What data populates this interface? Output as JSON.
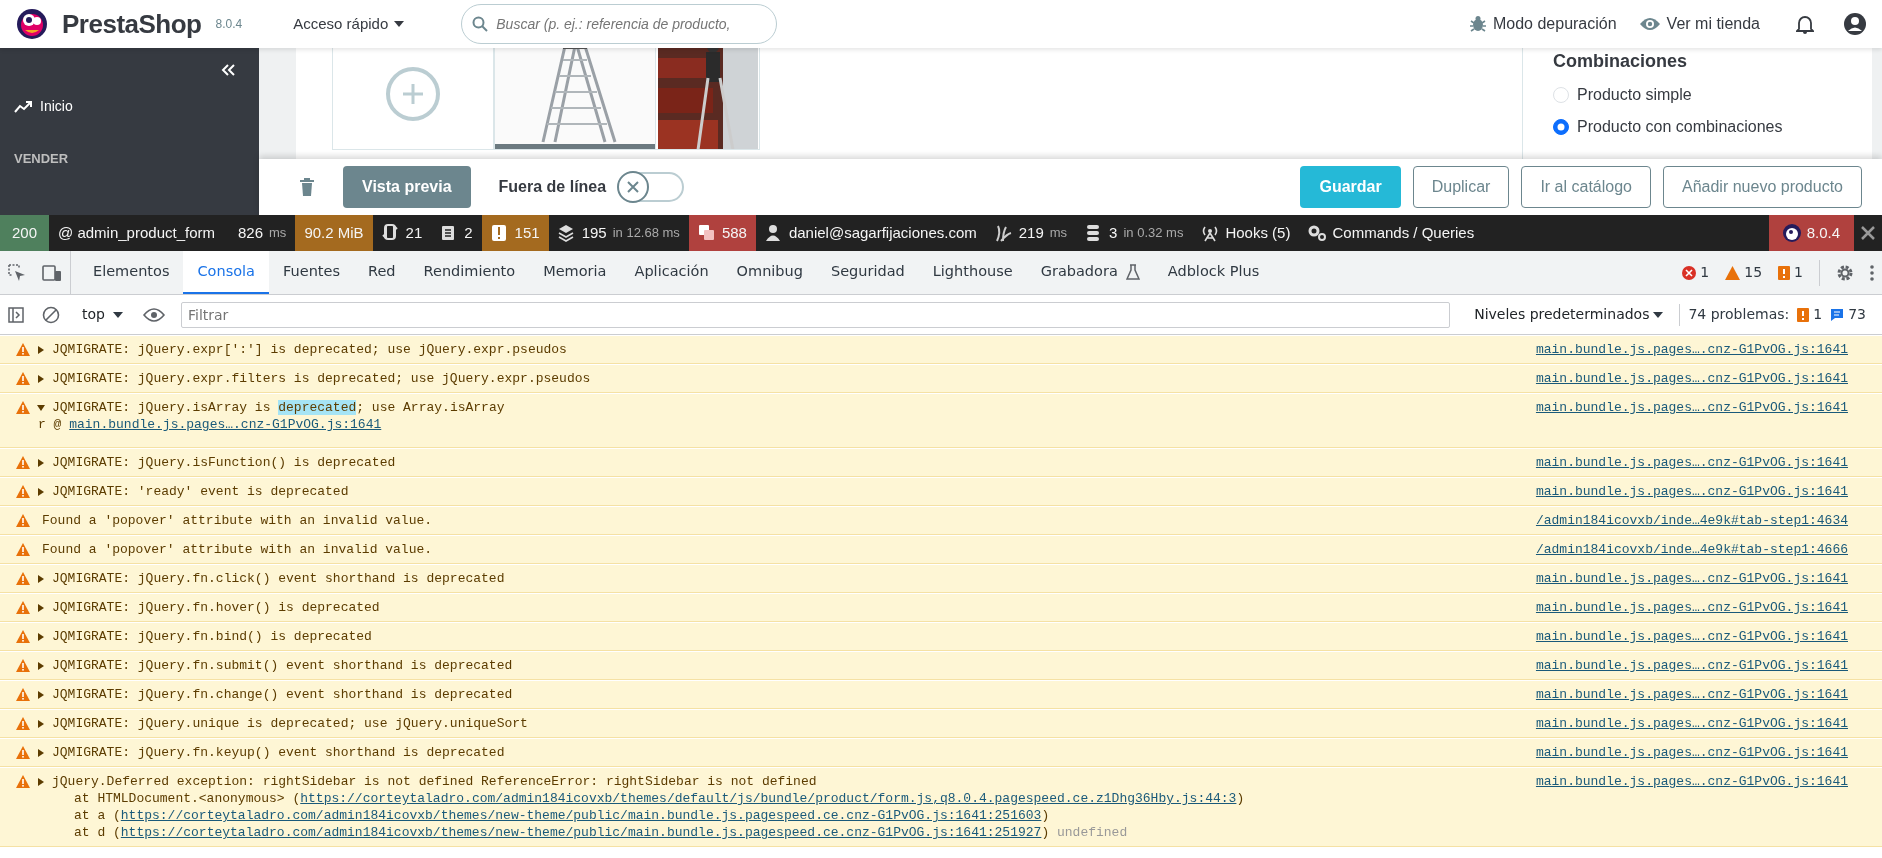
{
  "header": {
    "logo": "PrestaShop",
    "version": "8.0.4",
    "quick_access": "Acceso rápido",
    "search": {
      "placeholder": "Buscar (p. ej.: referencia de producto,"
    },
    "debug_mode": "Modo depuración",
    "view_shop": "Ver mi tienda"
  },
  "sidebar": {
    "items": [
      {
        "kind": "link",
        "label": "Inicio"
      },
      {
        "kind": "section",
        "label": "VENDER"
      }
    ]
  },
  "product": {
    "images": [
      {
        "kind": "add"
      },
      {
        "kind": "picture"
      },
      {
        "kind": "picture"
      }
    ],
    "combinations_title": "Combinaciones",
    "type_options": [
      {
        "label": "Producto simple",
        "selected": false
      },
      {
        "label": "Producto con combinaciones",
        "selected": true
      }
    ]
  },
  "action_bar": {
    "preview": "Vista previa",
    "offline_label": "Fuera de línea",
    "online": false,
    "buttons": [
      {
        "label": "Guardar",
        "kind": "primary"
      },
      {
        "label": "Duplicar",
        "kind": "outline"
      },
      {
        "label": "Ir al catálogo",
        "kind": "outline"
      },
      {
        "label": "Añadir nuevo producto",
        "kind": "outline"
      }
    ]
  },
  "debug_toolbar": [
    {
      "kind": "status",
      "text": "200",
      "color": "#4f805d"
    },
    {
      "kind": "route",
      "text": "@ admin_product_form"
    },
    {
      "kind": "time",
      "text": "826",
      "unit": "ms"
    },
    {
      "kind": "memory",
      "text": "90.2 MiB",
      "color": "#a46a1f"
    },
    {
      "kind": "ajax",
      "text": "21"
    },
    {
      "kind": "forms",
      "text": "2"
    },
    {
      "kind": "logger",
      "text": "151",
      "color": "#a46a1f"
    },
    {
      "kind": "cache",
      "text": "195",
      "unit": "in 12.68 ms"
    },
    {
      "kind": "translation",
      "text": "588",
      "color": "#b0413e"
    },
    {
      "kind": "user",
      "text": "daniel@sagarfijaciones.com"
    },
    {
      "kind": "twig",
      "text": "219",
      "unit": "ms"
    },
    {
      "kind": "db",
      "text": "3",
      "unit": "in 0.32 ms"
    },
    {
      "kind": "hooks",
      "text": "Hooks (5)"
    },
    {
      "kind": "commands",
      "text": "Commands / Queries"
    },
    {
      "kind": "version",
      "text": "8.0.4",
      "color": "#b0413e"
    }
  ],
  "devtools": {
    "tabs": [
      {
        "label": "Elementos",
        "selected": false
      },
      {
        "label": "Consola",
        "selected": true
      },
      {
        "label": "Fuentes",
        "selected": false
      },
      {
        "label": "Red",
        "selected": false
      },
      {
        "label": "Rendimiento",
        "selected": false
      },
      {
        "label": "Memoria",
        "selected": false
      },
      {
        "label": "Aplicación",
        "selected": false
      },
      {
        "label": "Omnibug",
        "selected": false
      },
      {
        "label": "Seguridad",
        "selected": false
      },
      {
        "label": "Lighthouse",
        "selected": false
      },
      {
        "label": "Grabadora",
        "selected": false,
        "experimental": true
      },
      {
        "label": "Adblock Plus",
        "selected": false
      }
    ],
    "counts": {
      "errors": "1",
      "warnings": "15",
      "issues": "1"
    },
    "context": "top",
    "filter_placeholder": "Filtrar",
    "levels": "Niveles predeterminados",
    "problems_label": "74 problemas:",
    "problems_issues": "1",
    "problems_info": "73"
  },
  "console": [
    {
      "parts": [
        {
          "text": "JQMIGRATE: jQuery.expr[':'] is deprecated; use jQuery.expr.pseudos"
        }
      ],
      "expandable": true,
      "expanded": false,
      "source": "main.bundle.js.pages….cnz-G1PvOG.js:1641"
    },
    {
      "parts": [
        {
          "text": "JQMIGRATE: jQuery.expr.filters is deprecated; use jQuery.expr.pseudos"
        }
      ],
      "expandable": true,
      "expanded": false,
      "source": "main.bundle.js.pages….cnz-G1PvOG.js:1641"
    },
    {
      "parts": [
        {
          "text": "JQMIGRATE: jQuery.isArray is "
        },
        {
          "text": "deprecated",
          "highlighted": true
        },
        {
          "text": "; use Array.isArray"
        }
      ],
      "expandable": true,
      "expanded": true,
      "source": "main.bundle.js.pages….cnz-G1PvOG.js:1641",
      "stack": [
        {
          "prefix": "r @ ",
          "link": "main.bundle.js.pages….cnz-G1PvOG.js:1641"
        }
      ]
    },
    {
      "parts": [
        {
          "text": "JQMIGRATE: jQuery.isFunction() is deprecated"
        }
      ],
      "expandable": true,
      "expanded": false,
      "source": "main.bundle.js.pages….cnz-G1PvOG.js:1641"
    },
    {
      "parts": [
        {
          "text": "JQMIGRATE: 'ready' event is deprecated"
        }
      ],
      "expandable": true,
      "expanded": false,
      "source": "main.bundle.js.pages….cnz-G1PvOG.js:1641"
    },
    {
      "parts": [
        {
          "text": "Found a 'popover' attribute with an invalid value."
        }
      ],
      "expandable": false,
      "source": "/admin184icovxb/inde…4e9k#tab-step1:4634"
    },
    {
      "parts": [
        {
          "text": "Found a 'popover' attribute with an invalid value."
        }
      ],
      "expandable": false,
      "source": "/admin184icovxb/inde…4e9k#tab-step1:4666"
    },
    {
      "parts": [
        {
          "text": "JQMIGRATE: jQuery.fn.click() event shorthand is deprecated"
        }
      ],
      "expandable": true,
      "expanded": false,
      "source": "main.bundle.js.pages….cnz-G1PvOG.js:1641"
    },
    {
      "parts": [
        {
          "text": "JQMIGRATE: jQuery.fn.hover() is deprecated"
        }
      ],
      "expandable": true,
      "expanded": false,
      "source": "main.bundle.js.pages….cnz-G1PvOG.js:1641"
    },
    {
      "parts": [
        {
          "text": "JQMIGRATE: jQuery.fn.bind() is deprecated"
        }
      ],
      "expandable": true,
      "expanded": false,
      "source": "main.bundle.js.pages….cnz-G1PvOG.js:1641"
    },
    {
      "parts": [
        {
          "text": "JQMIGRATE: jQuery.fn.submit() event shorthand is deprecated"
        }
      ],
      "expandable": true,
      "expanded": false,
      "source": "main.bundle.js.pages….cnz-G1PvOG.js:1641"
    },
    {
      "parts": [
        {
          "text": "JQMIGRATE: jQuery.fn.change() event shorthand is deprecated"
        }
      ],
      "expandable": true,
      "expanded": false,
      "source": "main.bundle.js.pages….cnz-G1PvOG.js:1641"
    },
    {
      "parts": [
        {
          "text": "JQMIGRATE: jQuery.unique is deprecated; use jQuery.uniqueSort"
        }
      ],
      "expandable": true,
      "expanded": false,
      "source": "main.bundle.js.pages….cnz-G1PvOG.js:1641"
    },
    {
      "parts": [
        {
          "text": "JQMIGRATE: jQuery.fn.keyup() event shorthand is deprecated"
        }
      ],
      "expandable": true,
      "expanded": false,
      "source": "main.bundle.js.pages….cnz-G1PvOG.js:1641"
    },
    {
      "parts": [
        {
          "text": "jQuery.Deferred exception: rightSidebar is not defined ReferenceError: rightSidebar is not defined"
        }
      ],
      "expandable": true,
      "expanded": false,
      "source": "main.bundle.js.pages….cnz-G1PvOG.js:1641",
      "stack": [
        {
          "prefix": "at HTMLDocument.<anonymous> (",
          "link": "https://corteytaladro.com/admin184icovxb/themes/default/js/bundle/product/form.js,q8.0.4.pagespeed.ce.z1Dhg36Hby.js:44:3",
          "suffix": ")"
        },
        {
          "prefix": "at a (",
          "link": "https://corteytaladro.com/admin184icovxb/themes/new-theme/public/main.bundle.js.pagespeed.ce.cnz-G1PvOG.js:1641:251603",
          "suffix": ")"
        },
        {
          "prefix": "at d (",
          "link": "https://corteytaladro.com/admin184icovxb/themes/new-theme/public/main.bundle.js.pagespeed.ce.cnz-G1PvOG.js:1641:251927",
          "suffix": ")",
          "note": "undefined"
        }
      ]
    }
  ]
}
